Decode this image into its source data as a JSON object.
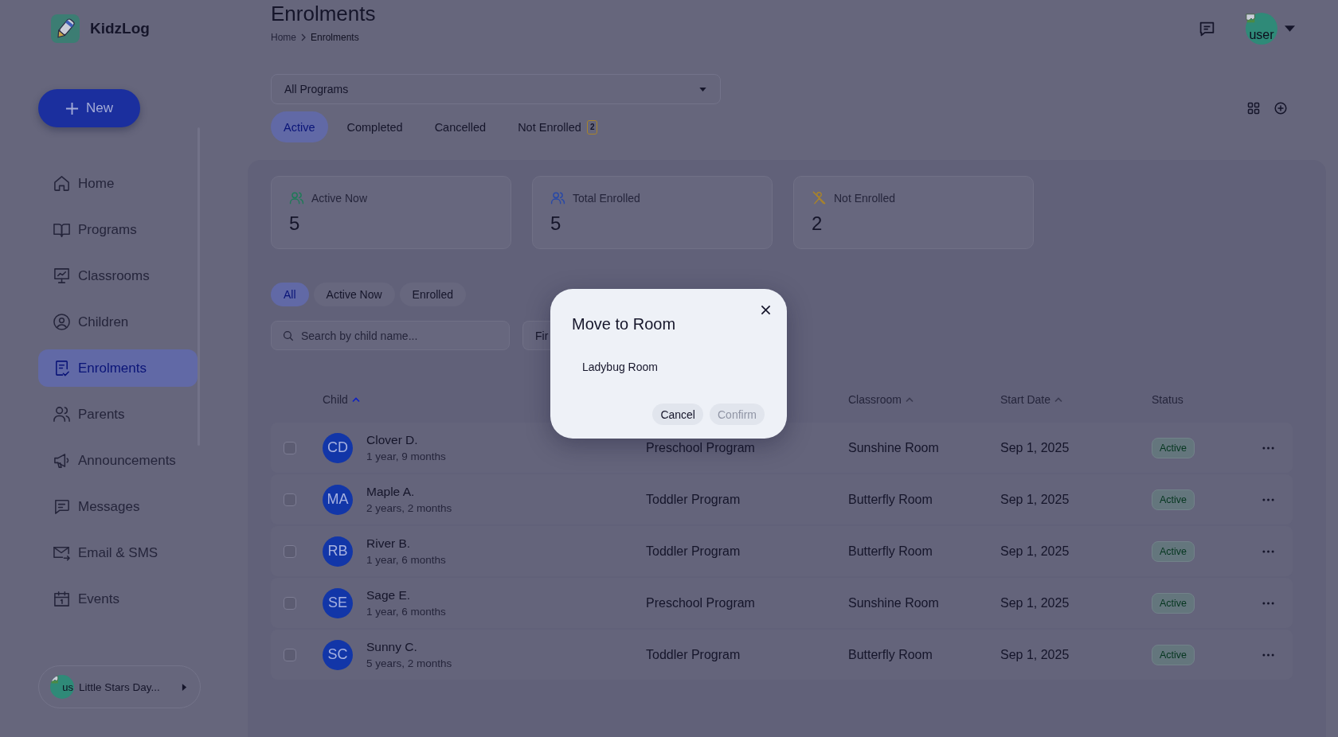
{
  "app": {
    "name": "KidzLog"
  },
  "new_button": {
    "label": "New"
  },
  "sidebar": {
    "items": [
      {
        "label": "Home",
        "selected": false
      },
      {
        "label": "Programs",
        "selected": false
      },
      {
        "label": "Classrooms",
        "selected": false
      },
      {
        "label": "Children",
        "selected": false
      },
      {
        "label": "Enrolments",
        "selected": true
      },
      {
        "label": "Parents",
        "selected": false
      },
      {
        "label": "Announcements",
        "selected": false
      },
      {
        "label": "Messages",
        "selected": false
      },
      {
        "label": "Email & SMS",
        "selected": false
      },
      {
        "label": "Events",
        "selected": false
      }
    ]
  },
  "org_switcher": {
    "avatar_alt": "us",
    "label": "Little Stars Day..."
  },
  "header": {
    "title": "Enrolments",
    "breadcrumb": [
      "Home",
      "Enrolments"
    ],
    "user_avatar_alt": "user"
  },
  "program_select": {
    "value": "All Programs"
  },
  "tabs": [
    {
      "label": "Active",
      "selected": true
    },
    {
      "label": "Completed",
      "selected": false
    },
    {
      "label": "Cancelled",
      "selected": false
    },
    {
      "label": "Not Enrolled",
      "selected": false,
      "badge": "2"
    }
  ],
  "stats": [
    {
      "label": "Active Now",
      "value": "5",
      "color": "#1f7a58"
    },
    {
      "label": "Total Enrolled",
      "value": "5",
      "color": "#2748a8"
    },
    {
      "label": "Not Enrolled",
      "value": "2",
      "color": "#a8832a"
    }
  ],
  "filter_chips": [
    {
      "label": "All",
      "selected": true
    },
    {
      "label": "Active Now",
      "selected": false
    },
    {
      "label": "Enrolled",
      "selected": false
    }
  ],
  "search": {
    "placeholder": "Search by child name..."
  },
  "field_2": {
    "value": "Fir"
  },
  "table": {
    "columns": [
      {
        "label": "Child",
        "sortable": true,
        "sorted": true
      },
      {
        "label": "Classroom",
        "sortable": true,
        "sorted": false
      },
      {
        "label": "Start Date",
        "sortable": true,
        "sorted": false
      },
      {
        "label": "Status",
        "sortable": false
      }
    ],
    "rows": [
      {
        "checked": false,
        "initials": "CD",
        "name": "Clover D.",
        "age": "1 year, 9 months",
        "program": "Preschool Program",
        "classroom": "Sunshine Room",
        "start_date": "Sep 1, 2025",
        "status": "Active"
      },
      {
        "checked": false,
        "initials": "MA",
        "name": "Maple A.",
        "age": "2 years, 2 months",
        "program": "Toddler Program",
        "classroom": "Butterfly Room",
        "start_date": "Sep 1, 2025",
        "status": "Active"
      },
      {
        "checked": false,
        "initials": "RB",
        "name": "River B.",
        "age": "1 year, 6 months",
        "program": "Toddler Program",
        "classroom": "Butterfly Room",
        "start_date": "Sep 1, 2025",
        "status": "Active"
      },
      {
        "checked": false,
        "initials": "SE",
        "name": "Sage E.",
        "age": "1 year, 6 months",
        "program": "Preschool Program",
        "classroom": "Sunshine Room",
        "start_date": "Sep 1, 2025",
        "status": "Active"
      },
      {
        "checked": false,
        "initials": "SC",
        "name": "Sunny C.",
        "age": "5 years, 2 months",
        "program": "Toddler Program",
        "classroom": "Butterfly Room",
        "start_date": "Sep 1, 2025",
        "status": "Active"
      }
    ]
  },
  "modal": {
    "title": "Move to Room",
    "option": "Ladybug Room",
    "buttons": [
      {
        "label": "Cancel",
        "disabled": false
      },
      {
        "label": "Confirm",
        "disabled": true
      }
    ]
  }
}
